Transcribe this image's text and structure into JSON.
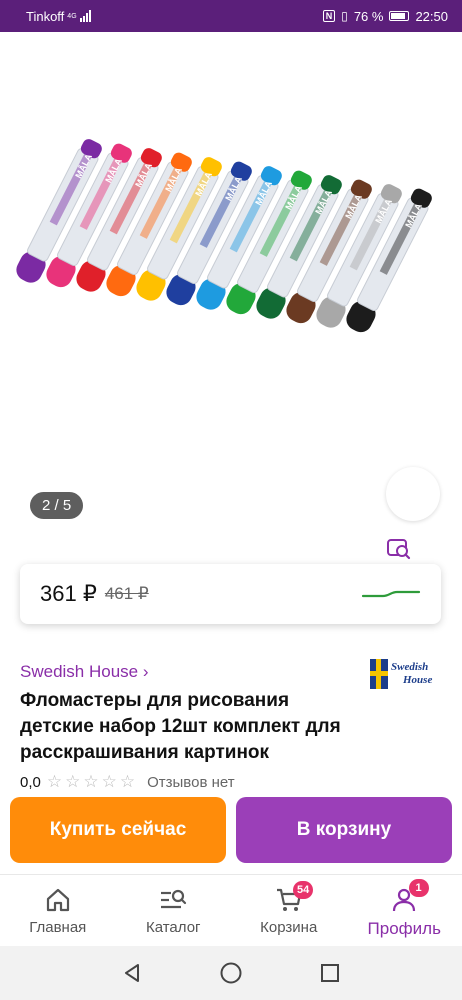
{
  "status_bar": {
    "carrier": "Tinkoff",
    "network": "4G",
    "battery_percent": "76 %",
    "battery_level": 0.76,
    "time": "22:50"
  },
  "gallery": {
    "counter": "2 / 5",
    "marker_colors": [
      "#7b2aa3",
      "#e8337a",
      "#e0202a",
      "#ff6a10",
      "#ffc000",
      "#1f3f9f",
      "#1e9be0",
      "#22a83a",
      "#126b35",
      "#6b3a22",
      "#a8a8a8",
      "#1c1c1c"
    ],
    "pen_brand_text": "MÅLA"
  },
  "product": {
    "price": "361 ₽",
    "old_price": "461 ₽",
    "brand_link": "Swedish House ›",
    "brand_logo_text": [
      "Swedish",
      "House"
    ],
    "title": "Фломастеры для рисования детские набор 12шт комплект для расскрашивания картинок",
    "rating_value": "0,0",
    "rating_stars": 0,
    "reviews": "Отзывов нет"
  },
  "actions": {
    "buy_now": "Купить сейчас",
    "add_to_cart": "В корзину"
  },
  "bottom_nav": {
    "items": [
      {
        "label": "Главная"
      },
      {
        "label": "Каталог"
      },
      {
        "label": "Корзина",
        "badge": "54"
      },
      {
        "label": "Профиль",
        "badge": "1"
      }
    ]
  },
  "colors": {
    "accent": "#8a2ea8",
    "buy_button": "#ff8c0a",
    "cart_button": "#9b3fb8",
    "badge": "#e8336b",
    "status_bar": "#5b1f7a",
    "trend_line": "#2e9b3a"
  }
}
